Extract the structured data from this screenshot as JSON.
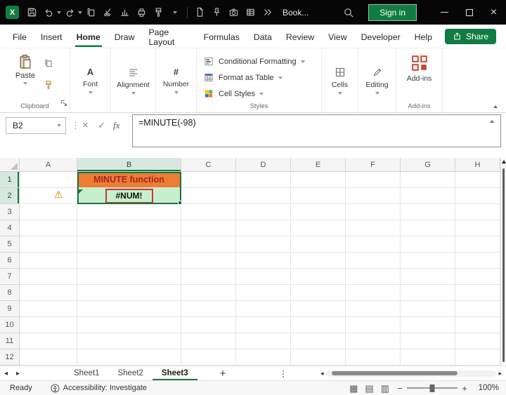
{
  "colors": {
    "excel_green": "#107C41",
    "titlebar_bg": "#000000",
    "heading_fill": "#ED7D31",
    "heading_text": "#A4262C",
    "error_fill": "#C6EFCE",
    "annotation_red": "#D0342C",
    "addins_icon": "#C74634",
    "selection_border": "#1A7340"
  },
  "title_bar": {
    "app_title": "Book...",
    "sign_in": "Sign in",
    "quick_access_icons": [
      "excel-logo",
      "save",
      "undo",
      "redo",
      "copy",
      "cut",
      "chart",
      "printer",
      "format-painter",
      "menu-chevron",
      "new-document",
      "pin",
      "camera",
      "table",
      "more-commands",
      "search"
    ],
    "window_controls": [
      "minimize",
      "maximize",
      "close"
    ]
  },
  "menu": {
    "items": [
      "File",
      "Insert",
      "Home",
      "Draw",
      "Page Layout",
      "Formulas",
      "Data",
      "Review",
      "View",
      "Developer",
      "Help"
    ],
    "active_item": "Home",
    "share": "Share"
  },
  "ribbon": {
    "paste": "Paste",
    "clipboard_group": "Clipboard",
    "font_group": "Font",
    "alignment_group": "Alignment",
    "number_group": "Number",
    "styles": {
      "conditional_formatting": "Conditional Formatting",
      "format_as_table": "Format as Table",
      "cell_styles": "Cell Styles",
      "group": "Styles"
    },
    "cells_group": "Cells",
    "editing_group": "Editing",
    "addins_button": "Add-ins",
    "addins_group": "Add-ins"
  },
  "formula_bar": {
    "name_box": "B2",
    "separator": "⋮",
    "cancel": "×",
    "enter": "✓",
    "function_label": "fx",
    "formula": "=MINUTE(-98)"
  },
  "grid": {
    "columns": [
      "A",
      "B",
      "C",
      "D",
      "E",
      "F",
      "G",
      "H"
    ],
    "rows": [
      "1",
      "2",
      "3",
      "4",
      "5",
      "6",
      "7",
      "8",
      "9",
      "10",
      "11",
      "12"
    ],
    "cells": {
      "B1": "MINUTE function",
      "B2": "#NUM!"
    },
    "active_cell": "B2",
    "selected_range": "B1:B2"
  },
  "sheet_tabs": {
    "tabs": [
      "Sheet1",
      "Sheet2",
      "Sheet3"
    ],
    "active_tab": "Sheet3",
    "add_label": "+",
    "more_label": "⋮"
  },
  "status_bar": {
    "mode": "Ready",
    "accessibility_status": "Accessibility: Investigate",
    "view_icons": [
      "normal-view",
      "page-layout",
      "page-break-preview"
    ],
    "zoom_out": "−",
    "zoom_in": "+",
    "zoom_level": "100%"
  }
}
